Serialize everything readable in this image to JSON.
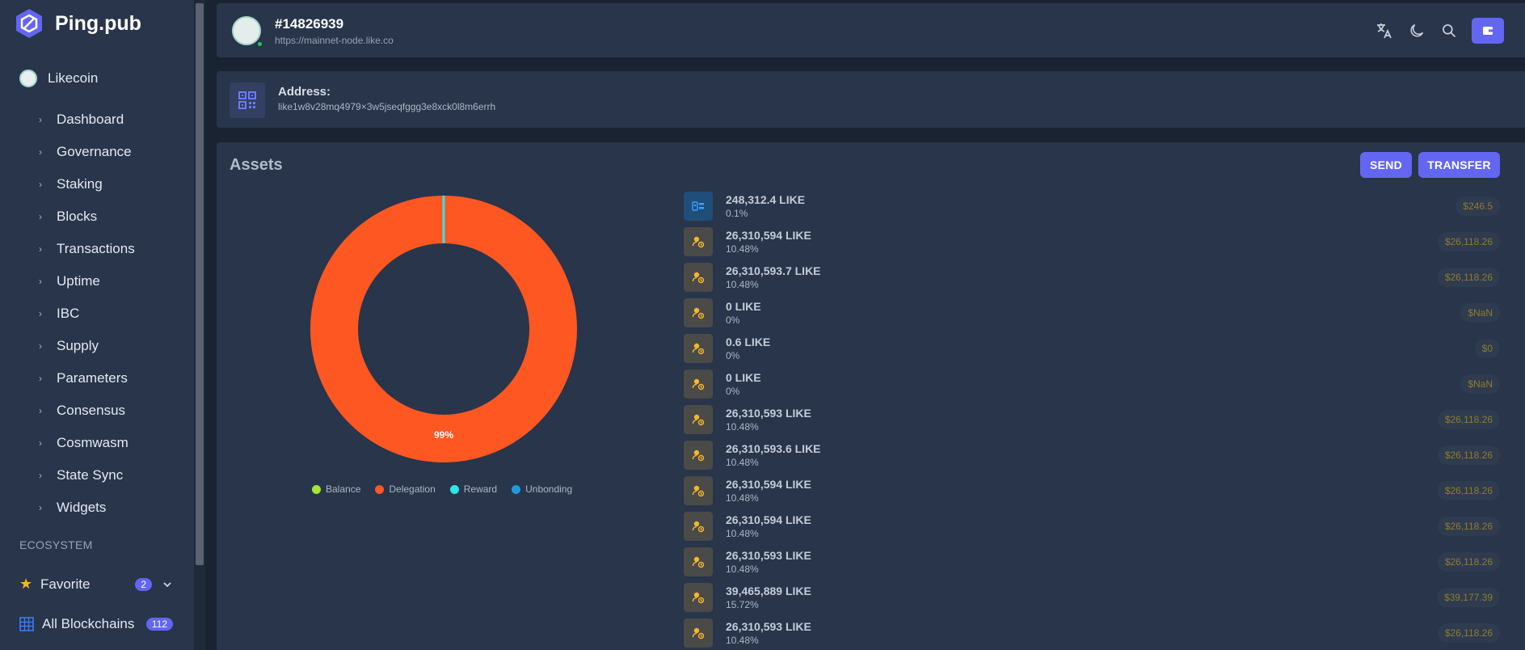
{
  "app": {
    "name": "Ping.pub",
    "logo_icon": "hexagon-logo-icon"
  },
  "sidebar": {
    "chain": "Likecoin",
    "items": [
      {
        "label": "Dashboard"
      },
      {
        "label": "Governance"
      },
      {
        "label": "Staking"
      },
      {
        "label": "Blocks"
      },
      {
        "label": "Transactions"
      },
      {
        "label": "Uptime"
      },
      {
        "label": "IBC"
      },
      {
        "label": "Supply"
      },
      {
        "label": "Parameters"
      },
      {
        "label": "Consensus"
      },
      {
        "label": "Cosmwasm"
      },
      {
        "label": "State Sync"
      },
      {
        "label": "Widgets"
      }
    ],
    "section_label": "ECOSYSTEM",
    "favorite": {
      "label": "Favorite",
      "count": "2"
    },
    "all_blockchains": {
      "label": "All Blockchains",
      "count": "112"
    }
  },
  "header": {
    "block_height": "#14826939",
    "node_url": "https://mainnet-node.like.co",
    "status_color": "#22c55e"
  },
  "address": {
    "label": "Address:",
    "value": "like1w8v28mq4979×3w5jseqfggg3e8xck0l8m6errh"
  },
  "assets": {
    "title": "Assets",
    "send_label": "SEND",
    "transfer_label": "TRANSFER",
    "chart_data": {
      "type": "pie",
      "categories": [
        "Balance",
        "Delegation",
        "Reward",
        "Unbonding"
      ],
      "values": [
        0.1,
        99.9,
        0,
        0
      ],
      "colors": [
        "#a3e635",
        "#ff5722",
        "#2ee6e6",
        "#1e9be0"
      ],
      "data_label": "99%",
      "legend_position": "bottom"
    },
    "rows": [
      {
        "type": "balance",
        "amount": "248,312.4 LIKE",
        "percent": "0.1%",
        "value": "$246.5"
      },
      {
        "type": "delegation",
        "amount": "26,310,594 LIKE",
        "percent": "10.48%",
        "value": "$26,118.26"
      },
      {
        "type": "delegation",
        "amount": "26,310,593.7 LIKE",
        "percent": "10.48%",
        "value": "$26,118.26"
      },
      {
        "type": "delegation",
        "amount": "0 LIKE",
        "percent": "0%",
        "value": "$NaN"
      },
      {
        "type": "delegation",
        "amount": "0.6 LIKE",
        "percent": "0%",
        "value": "$0"
      },
      {
        "type": "delegation",
        "amount": "0 LIKE",
        "percent": "0%",
        "value": "$NaN"
      },
      {
        "type": "delegation",
        "amount": "26,310,593 LIKE",
        "percent": "10.48%",
        "value": "$26,118.26"
      },
      {
        "type": "delegation",
        "amount": "26,310,593.6 LIKE",
        "percent": "10.48%",
        "value": "$26,118.26"
      },
      {
        "type": "delegation",
        "amount": "26,310,594 LIKE",
        "percent": "10.48%",
        "value": "$26,118.26"
      },
      {
        "type": "delegation",
        "amount": "26,310,594 LIKE",
        "percent": "10.48%",
        "value": "$26,118.26"
      },
      {
        "type": "delegation",
        "amount": "26,310,593 LIKE",
        "percent": "10.48%",
        "value": "$26,118.26"
      },
      {
        "type": "delegation",
        "amount": "39,465,889 LIKE",
        "percent": "15.72%",
        "value": "$39,177.39"
      },
      {
        "type": "delegation",
        "amount": "26,310,593 LIKE",
        "percent": "10.48%",
        "value": "$26,118.26"
      }
    ]
  },
  "icons": {
    "header": [
      "translate-icon",
      "moon-icon",
      "search-icon",
      "wallet-icon"
    ]
  },
  "colors": {
    "accent": "#6366f1",
    "panel": "#28354b",
    "background": "#1a2332"
  }
}
